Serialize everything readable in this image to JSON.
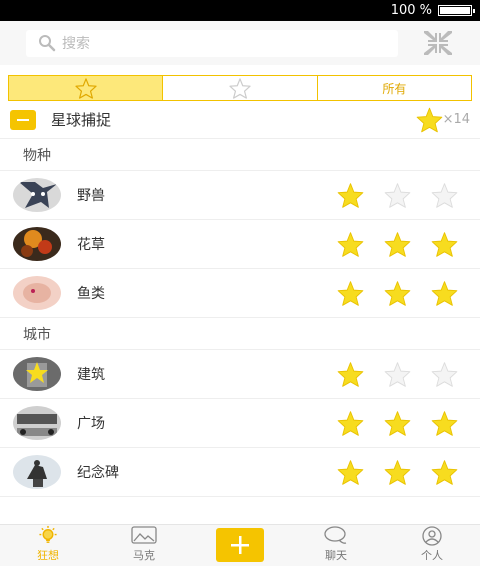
{
  "status_bar": {
    "battery_text": "100 %"
  },
  "search": {
    "placeholder": "搜索"
  },
  "filter_tabs": [
    {
      "icon": "star-filled-icon"
    },
    {
      "icon": "star-outline-icon"
    },
    {
      "label": "所有"
    }
  ],
  "group": {
    "title": "星球捕捉",
    "count": "×14"
  },
  "sections": [
    {
      "title": "物种",
      "items": [
        {
          "label": "野兽",
          "avatar": "wolf",
          "stars": [
            true,
            false,
            false
          ]
        },
        {
          "label": "花草",
          "avatar": "flower",
          "stars": [
            true,
            true,
            true
          ]
        },
        {
          "label": "鱼类",
          "avatar": "fish",
          "stars": [
            true,
            true,
            true
          ]
        }
      ]
    },
    {
      "title": "城市",
      "items": [
        {
          "label": "建筑",
          "avatar": "building",
          "stars": [
            true,
            false,
            false
          ]
        },
        {
          "label": "广场",
          "avatar": "square",
          "stars": [
            true,
            true,
            true
          ]
        },
        {
          "label": "纪念碑",
          "avatar": "monument",
          "stars": [
            true,
            true,
            true
          ]
        }
      ]
    }
  ],
  "tabbar": [
    {
      "label": "狂想",
      "icon": "lightbulb-icon",
      "active": true
    },
    {
      "label": "马克",
      "icon": "image-icon",
      "active": false
    },
    {
      "label": "",
      "icon": "plus-icon",
      "active": false
    },
    {
      "label": "聊天",
      "icon": "chat-bubble-icon",
      "active": false
    },
    {
      "label": "个人",
      "icon": "person-icon",
      "active": false
    }
  ],
  "colors": {
    "accent": "#F5C400",
    "star_filled": "#F7DC1F",
    "star_empty": "#E8E8E8"
  }
}
